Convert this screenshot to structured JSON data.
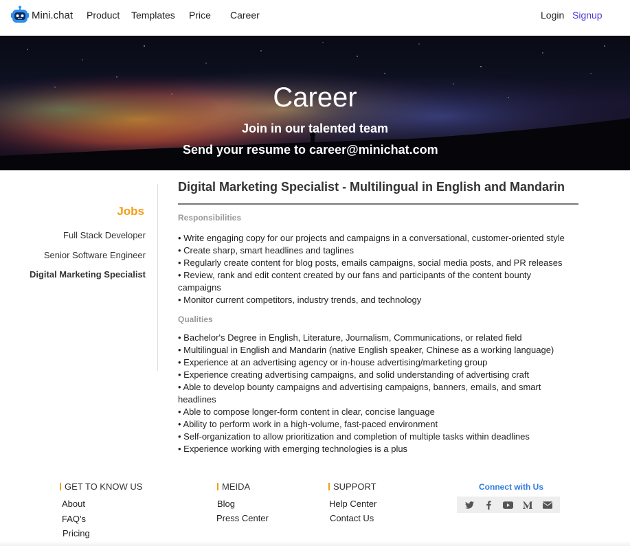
{
  "nav": {
    "logo_text": "Mini.chat",
    "links": [
      "Product",
      "Templates",
      "Price",
      "Career"
    ],
    "login": "Login",
    "signup": "Signup"
  },
  "hero": {
    "title": "Career",
    "subtitle": "Join in our talented team",
    "contact": "Send your resume to career@minichat.com"
  },
  "sidebar": {
    "title": "Jobs",
    "jobs": [
      "Full Stack Developer",
      "Senior Software Engineer",
      "Digital Marketing Specialist"
    ],
    "active_index": 2
  },
  "job": {
    "title": "Digital Marketing Specialist - Multilingual in English and Mandarin",
    "responsibilities_heading": "Responsibilities",
    "responsibilities": [
      "• Write engaging copy for our projects and campaigns in a conversational, customer-oriented style",
      "• Create sharp, smart headlines and taglines",
      "• Regularly create content for blog posts, emails campaigns, social media posts, and PR releases",
      "• Review, rank and edit content created by our fans and participants of the content bounty campaigns",
      "• Monitor current competitors, industry trends, and technology"
    ],
    "qualities_heading": "Qualities",
    "qualities": [
      "• Bachelor's Degree in English, Literature, Journalism, Communications, or related field",
      "• Multilingual in English and Mandarin (native English speaker, Chinese as a working language)",
      "• Experience at an advertising agency or in-house advertising/marketing group",
      "• Experience creating advertising campaigns, and solid understanding of advertising craft",
      "• Able to develop bounty campaigns and advertising campaigns, banners, emails, and smart headlines",
      "• Able to compose longer-form content in clear, concise language",
      "• Ability to perform work in a high-volume, fast-paced environment",
      "• Self-organization to allow prioritization and completion of multiple tasks within deadlines",
      "• Experience working with emerging technologies is a plus"
    ]
  },
  "footer": {
    "col1": {
      "heading": "GET TO KNOW US",
      "links": [
        "About",
        "FAQ's",
        "Pricing"
      ]
    },
    "col2": {
      "heading": "MEIDA",
      "links": [
        "Blog",
        "Press Center"
      ]
    },
    "col3": {
      "heading": "SUPPORT",
      "links": [
        "Help Center",
        "Contact Us"
      ]
    },
    "connect": "Connect with Us",
    "social_icons": [
      "twitter-icon",
      "facebook-icon",
      "youtube-icon",
      "medium-icon",
      "email-icon"
    ]
  },
  "colors": {
    "accent_orange": "#f39c12",
    "signup_purple": "#4a3ad6",
    "connect_blue": "#2e7be0",
    "logo_blue": "#2f8ff0"
  }
}
